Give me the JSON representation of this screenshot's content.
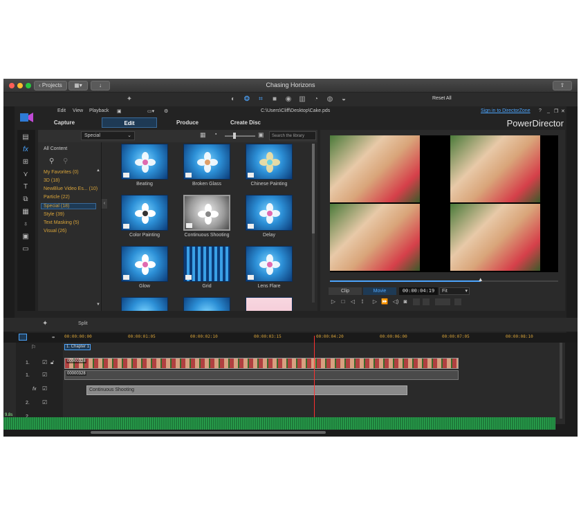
{
  "window": {
    "title": "Chasing Horizons",
    "projects_button": "Projects",
    "reset_all": "Reset All"
  },
  "menu": {
    "items": [
      "Edit",
      "View",
      "Playback"
    ],
    "file_path": "C:\\Users\\Cliff\\Desktop\\Cake.pds",
    "signin": "Sign in to DirectorZone",
    "help": "?"
  },
  "brand": "PowerDirector",
  "tabs": [
    {
      "label": "Capture",
      "active": false
    },
    {
      "label": "Edit",
      "active": true
    },
    {
      "label": "Produce",
      "active": false
    },
    {
      "label": "Create Disc",
      "active": false
    }
  ],
  "library": {
    "filter": "Special",
    "search_placeholder": "Search the library",
    "categories": [
      {
        "label": "All Content"
      },
      {
        "label": "My Favorites  (0)"
      },
      {
        "label": "3D  (18)"
      },
      {
        "label": "NewBlue Video Es...  (10)"
      },
      {
        "label": "Particle  (22)"
      },
      {
        "label": "Special  (18)"
      },
      {
        "label": "Style  (39)"
      },
      {
        "label": "Text Masking  (5)"
      },
      {
        "label": "Visual  (26)"
      }
    ],
    "effects": [
      {
        "label": "Beating"
      },
      {
        "label": "Broken Glass"
      },
      {
        "label": "Chinese Painting"
      },
      {
        "label": "Color Painting"
      },
      {
        "label": "Continuous Shooting"
      },
      {
        "label": "Delay"
      },
      {
        "label": "Glow"
      },
      {
        "label": "Grid"
      },
      {
        "label": "Lens Flare"
      }
    ]
  },
  "preview": {
    "modes": [
      "Clip",
      "Movie"
    ],
    "active_mode": "Movie",
    "timecode": "00:00:04:19",
    "fit": "Fit",
    "progress": 0.66
  },
  "timeline": {
    "split_label": "Split",
    "ruler": [
      "00:00:00:00",
      "00:00:01:05",
      "00:00:02:10",
      "00:00:03:15",
      "00:00:04:20",
      "00:00:06:00",
      "00:00:07:05",
      "00:00:08:10"
    ],
    "chapter": "1. Chapter 1",
    "video_clip_label": "00000328",
    "audio_clip_label": "00000328",
    "fx_clip_label": "Continuous Shooting",
    "track_labels": [
      "1.",
      "1.",
      "fx",
      "2.",
      "2."
    ],
    "audio_level": "9.8s"
  },
  "colors": {
    "accent": "#4da6ff",
    "category": "#d9a43a",
    "selection": "#1e3a55"
  }
}
